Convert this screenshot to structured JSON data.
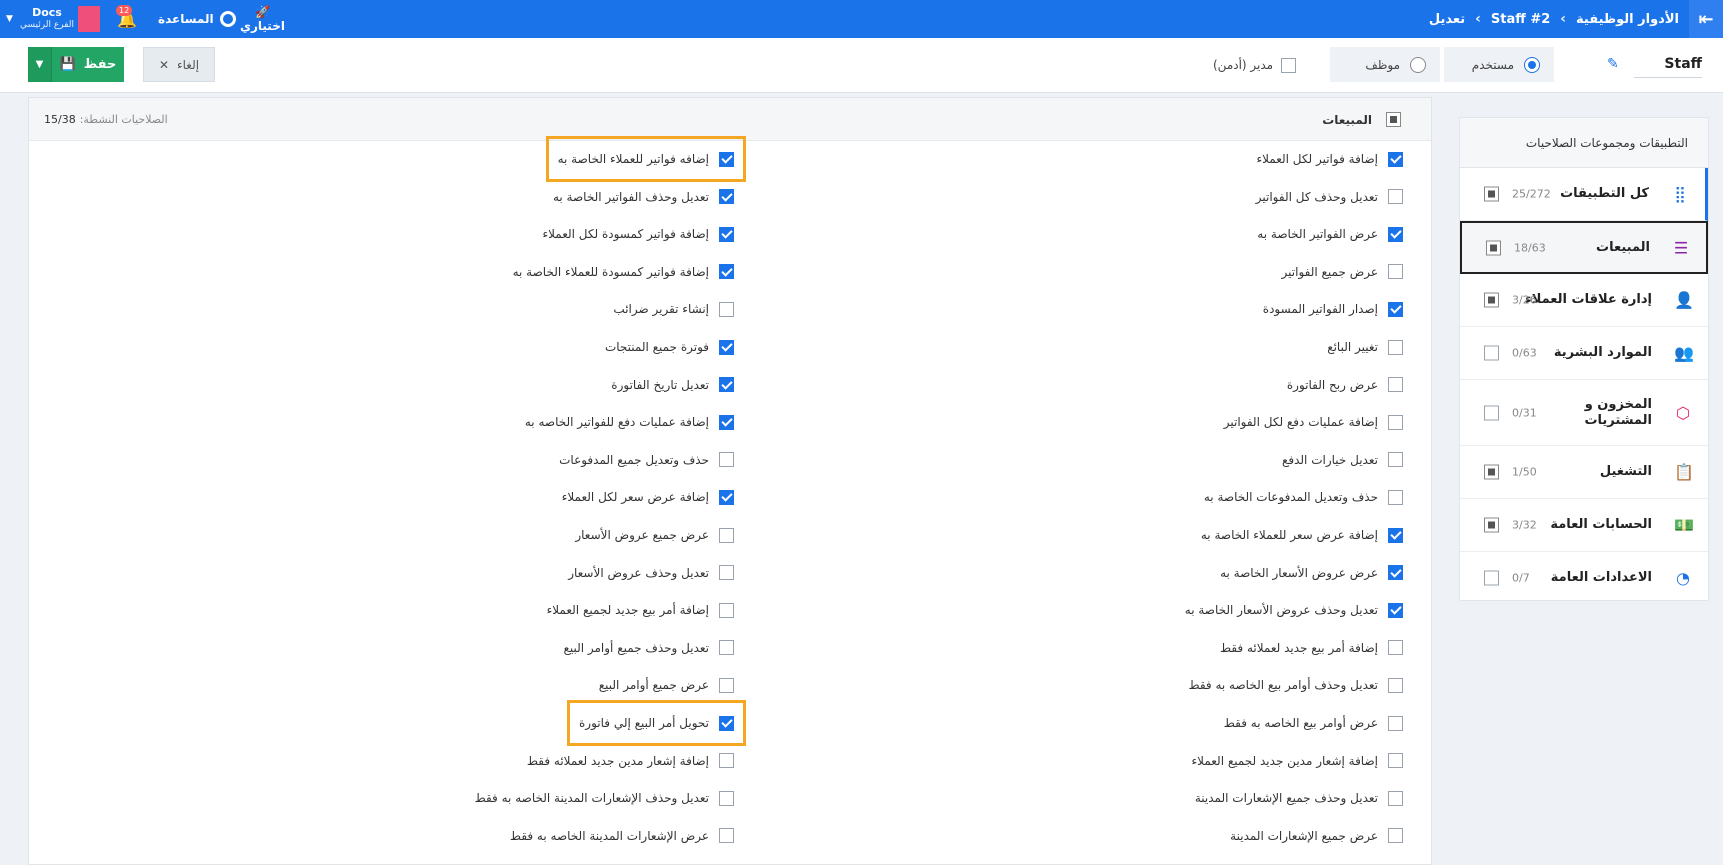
{
  "topbar": {
    "breadcrumb": [
      "الأدوار الوظيفية",
      "Staff #2",
      "تعديل"
    ],
    "rocket_label": "اختياري",
    "help_label": "المساعدة",
    "notifications_count": "12",
    "account_name": "Docs",
    "branch_name": "الفرع الرئيسي",
    "brand_color": "#1a73e8"
  },
  "actions": {
    "save_label": "حفظ",
    "cancel_label": "إلغاء",
    "admin_label": "مدير (أدمن)",
    "employee_label": "موظف",
    "user_label": "مستخدم",
    "selected_role": "user",
    "staff_name": "Staff"
  },
  "sidebar": {
    "title": "التطبيقات ومجموعات الصلاحيات",
    "items": [
      {
        "label": "كل التطبيقات",
        "count": "25/272",
        "icon": "grid-icon",
        "state": "partial"
      },
      {
        "label": "المبيعات",
        "count": "18/63",
        "icon": "list-icon",
        "state": "partial"
      },
      {
        "label": "إدارة علاقات العملاء",
        "count": "3/26",
        "icon": "user-tie-icon",
        "state": "partial"
      },
      {
        "label": "الموارد البشرية",
        "count": "0/63",
        "icon": "people-icon",
        "state": "off"
      },
      {
        "label": "المخزون و المشتريات",
        "count": "0/31",
        "icon": "box-icon",
        "state": "off"
      },
      {
        "label": "التشغيل",
        "count": "1/50",
        "icon": "clipboard-icon",
        "state": "partial"
      },
      {
        "label": "الحسابات العامة",
        "count": "3/32",
        "icon": "money-icon",
        "state": "partial"
      },
      {
        "label": "الاعدادات العامة",
        "count": "0/7",
        "icon": "gauge-icon",
        "state": "off"
      }
    ]
  },
  "panel": {
    "title": "المبيعات",
    "active_label": "الصلاحيات النشطة:",
    "active_count": "15/38",
    "right_column": [
      {
        "label": "إضافة فواتير لكل العملاء",
        "checked": true
      },
      {
        "label": "تعديل وحذف كل الفواتير",
        "checked": false
      },
      {
        "label": "عرض الفواتير الخاصة به",
        "checked": true
      },
      {
        "label": "عرض جميع الفواتير",
        "checked": false
      },
      {
        "label": "إصدار الفواتير المسودة",
        "checked": true
      },
      {
        "label": "تغيير البائع",
        "checked": false
      },
      {
        "label": "عرض ربح الفاتورة",
        "checked": false
      },
      {
        "label": "إضافة عمليات دفع لكل الفواتير",
        "checked": false
      },
      {
        "label": "تعديل خيارات الدفع",
        "checked": false
      },
      {
        "label": "حذف وتعديل المدفوعات الخاصة به",
        "checked": false
      },
      {
        "label": "إضافة عرض سعر للعملاء الخاصة به",
        "checked": true
      },
      {
        "label": "عرض عروض الأسعار الخاصة به",
        "checked": true
      },
      {
        "label": "تعديل وحذف عروض الأسعار الخاصة به",
        "checked": true
      },
      {
        "label": "إضافة أمر بيع جديد لعملائه فقط",
        "checked": false
      },
      {
        "label": "تعديل وحذف أوامر بيع الخاصه به فقط",
        "checked": false
      },
      {
        "label": "عرض أوامر بيع الخاصه به فقط",
        "checked": false
      },
      {
        "label": "إضافة إشعار مدين جديد لجميع العملاء",
        "checked": false
      },
      {
        "label": "تعديل وحذف جميع الإشعارات المدينة",
        "checked": false
      },
      {
        "label": "عرض جميع الإشعارات المدينة",
        "checked": false
      }
    ],
    "left_column": [
      {
        "label": "إضافه فواتير للعملاء الخاصة به",
        "checked": true,
        "highlight": true
      },
      {
        "label": "تعديل وحذف الفواتير الخاصة به",
        "checked": true
      },
      {
        "label": "إضافة فواتير كمسودة لكل العملاء",
        "checked": true
      },
      {
        "label": "إضافة فواتير كمسودة للعملاء الخاصة به",
        "checked": true
      },
      {
        "label": "إنشاء تقرير ضرائب",
        "checked": false
      },
      {
        "label": "فوترة جميع المنتجات",
        "checked": true
      },
      {
        "label": "تعديل تاريخ الفاتورة",
        "checked": true
      },
      {
        "label": "إضافة عمليات دفع للفواتير الخاصه به",
        "checked": true
      },
      {
        "label": "حذف وتعديل جميع المدفوعات",
        "checked": false
      },
      {
        "label": "إضافة عرض سعر لكل العملاء",
        "checked": true
      },
      {
        "label": "عرض جميع عروض الأسعار",
        "checked": false
      },
      {
        "label": "تعديل وحذف عروض الأسعار",
        "checked": false
      },
      {
        "label": "إضافة أمر بيع جديد لجميع العملاء",
        "checked": false
      },
      {
        "label": "تعديل وحذف جميع أوامر البيع",
        "checked": false
      },
      {
        "label": "عرض جميع أوامر البيع",
        "checked": false
      },
      {
        "label": "تحويل أمر البيع إلي فاتورة",
        "checked": true,
        "highlight": true
      },
      {
        "label": "إضافة إشعار مدين جديد لعملائه فقط",
        "checked": false
      },
      {
        "label": "تعديل وحذف الإشعارات المدينة الخاصه به فقط",
        "checked": false
      },
      {
        "label": "عرض الإشعارات المدينة الخاصه به فقط",
        "checked": false
      }
    ]
  }
}
